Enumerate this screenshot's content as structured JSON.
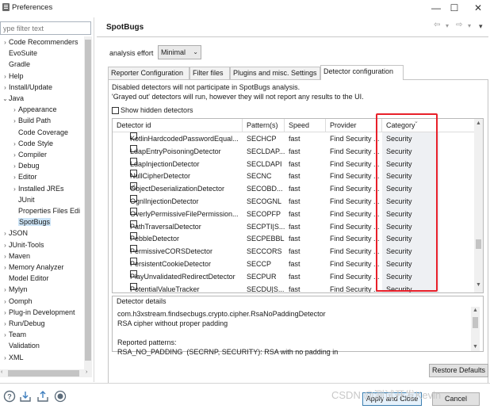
{
  "window": {
    "title": "Preferences",
    "controls": [
      "—",
      "☐",
      "✕"
    ]
  },
  "filter": {
    "placeholder": "ype filter text"
  },
  "tree": [
    {
      "label": "Code Recommenders",
      "depth": 0,
      "twisty": "›"
    },
    {
      "label": "EvoSuite",
      "depth": 0,
      "twisty": ""
    },
    {
      "label": "Gradle",
      "depth": 0,
      "twisty": ""
    },
    {
      "label": "Help",
      "depth": 0,
      "twisty": "›"
    },
    {
      "label": "Install/Update",
      "depth": 0,
      "twisty": "›"
    },
    {
      "label": "Java",
      "depth": 0,
      "twisty": "⌄"
    },
    {
      "label": "Appearance",
      "depth": 1,
      "twisty": "›"
    },
    {
      "label": "Build Path",
      "depth": 1,
      "twisty": "›"
    },
    {
      "label": "Code Coverage",
      "depth": 1,
      "twisty": ""
    },
    {
      "label": "Code Style",
      "depth": 1,
      "twisty": "›"
    },
    {
      "label": "Compiler",
      "depth": 1,
      "twisty": "›"
    },
    {
      "label": "Debug",
      "depth": 1,
      "twisty": "›"
    },
    {
      "label": "Editor",
      "depth": 1,
      "twisty": "›"
    },
    {
      "label": "Installed JREs",
      "depth": 1,
      "twisty": "›"
    },
    {
      "label": "JUnit",
      "depth": 1,
      "twisty": ""
    },
    {
      "label": "Properties Files Edi",
      "depth": 1,
      "twisty": ""
    },
    {
      "label": "SpotBugs",
      "depth": 1,
      "twisty": "",
      "selected": true
    },
    {
      "label": "JSON",
      "depth": 0,
      "twisty": "›"
    },
    {
      "label": "JUnit-Tools",
      "depth": 0,
      "twisty": "›"
    },
    {
      "label": "Maven",
      "depth": 0,
      "twisty": "›"
    },
    {
      "label": "Memory Analyzer",
      "depth": 0,
      "twisty": "›"
    },
    {
      "label": "Model Editor",
      "depth": 0,
      "twisty": ""
    },
    {
      "label": "Mylyn",
      "depth": 0,
      "twisty": "›"
    },
    {
      "label": "Oomph",
      "depth": 0,
      "twisty": "›"
    },
    {
      "label": "Plug-in Development",
      "depth": 0,
      "twisty": "›"
    },
    {
      "label": "Run/Debug",
      "depth": 0,
      "twisty": "›"
    },
    {
      "label": "Team",
      "depth": 0,
      "twisty": "›"
    },
    {
      "label": "Validation",
      "depth": 0,
      "twisty": ""
    },
    {
      "label": "XML",
      "depth": 0,
      "twisty": "›"
    }
  ],
  "page": {
    "title": "SpotBugs",
    "nav": {
      "back": "⇦",
      "back_menu": "▾",
      "forward": "⇨",
      "forward_menu": "▾",
      "menu": "▾"
    }
  },
  "effort": {
    "label": "analysis effort",
    "value": "Minimal",
    "arrow": "⌄"
  },
  "tabs": [
    {
      "label": "Reporter Configuration",
      "active": false
    },
    {
      "label": "Filter files",
      "active": false
    },
    {
      "label": "Plugins and misc. Settings",
      "active": false
    },
    {
      "label": "Detector configuration",
      "active": true
    }
  ],
  "info": {
    "line1": "Disabled detectors will not participate in SpotBugs analysis.",
    "line2": "'Grayed out' detectors will run, however they will not report any results to the UI."
  },
  "show_hidden": {
    "label": "Show hidden detectors",
    "checked": false
  },
  "table": {
    "columns": [
      "Detector id",
      "Pattern(s)",
      "Speed",
      "Provider",
      "Category"
    ],
    "sort_marker": "⌄",
    "scroll_up": "▲",
    "scroll_down": "▼",
    "rows": [
      {
        "id": "KotlinHardcodedPasswordEqual...",
        "pattern": "SECHCP",
        "speed": "fast",
        "provider": "Find Security ...",
        "category": "Security",
        "checked": false
      },
      {
        "id": "LdapEntryPoisoningDetector",
        "pattern": "SECLDAP...",
        "speed": "fast",
        "provider": "Find Security ...",
        "category": "Security",
        "checked": false
      },
      {
        "id": "LdapInjectionDetector",
        "pattern": "SECLDAPI",
        "speed": "fast",
        "provider": "Find Security ...",
        "category": "Security",
        "checked": false
      },
      {
        "id": "NullCipherDetector",
        "pattern": "SECNC",
        "speed": "fast",
        "provider": "Find Security ...",
        "category": "Security",
        "checked": false
      },
      {
        "id": "ObjectDeserializationDetector",
        "pattern": "SECOBD...",
        "speed": "fast",
        "provider": "Find Security ...",
        "category": "Security",
        "checked": true
      },
      {
        "id": "OgnlInjectionDetector",
        "pattern": "SECOGNL",
        "speed": "fast",
        "provider": "Find Security ...",
        "category": "Security",
        "checked": false
      },
      {
        "id": "OverlyPermissiveFilePermission...",
        "pattern": "SECOPFP",
        "speed": "fast",
        "provider": "Find Security ...",
        "category": "Security",
        "checked": false
      },
      {
        "id": "PathTraversalDetector",
        "pattern": "SECPTI|S...",
        "speed": "fast",
        "provider": "Find Security ...",
        "category": "Security",
        "checked": false
      },
      {
        "id": "PebbleDetector",
        "pattern": "SECPEBBLE",
        "speed": "fast",
        "provider": "Find Security ...",
        "category": "Security",
        "checked": false
      },
      {
        "id": "PermissiveCORSDetector",
        "pattern": "SECCORS",
        "speed": "fast",
        "provider": "Find Security ...",
        "category": "Security",
        "checked": false
      },
      {
        "id": "PersistentCookieDetector",
        "pattern": "SECCP",
        "speed": "fast",
        "provider": "Find Security ...",
        "category": "Security",
        "checked": false
      },
      {
        "id": "PlayUnvalidatedRedirectDetector",
        "pattern": "SECPUR",
        "speed": "fast",
        "provider": "Find Security ...",
        "category": "Security",
        "checked": false
      },
      {
        "id": "PotentialValueTracker",
        "pattern": "SECDU|S...",
        "speed": "fast",
        "provider": "Find Security ...",
        "category": "Security",
        "checked": false
      }
    ]
  },
  "details": {
    "title": "Detector details",
    "text": "com.h3xstream.findsecbugs.crypto.cipher.RsaNoPaddingDetector\nRSA cipher without proper padding\n\nReported patterns:\nRSA_NO_PADDING  (SECRNP, SECURITY): RSA with no padding in"
  },
  "buttons": {
    "restore": "Restore Defaults",
    "apply": "Apply and Close",
    "cancel": "Cancel"
  },
  "bottom_icons": [
    "help-icon",
    "import-icon",
    "export-icon",
    "record-icon"
  ],
  "watermark": "CSDN @测试开发Kevin",
  "colors": {
    "highlight": "#e8202a",
    "selection": "#cce4f7",
    "category_band": "#eef0f3"
  }
}
